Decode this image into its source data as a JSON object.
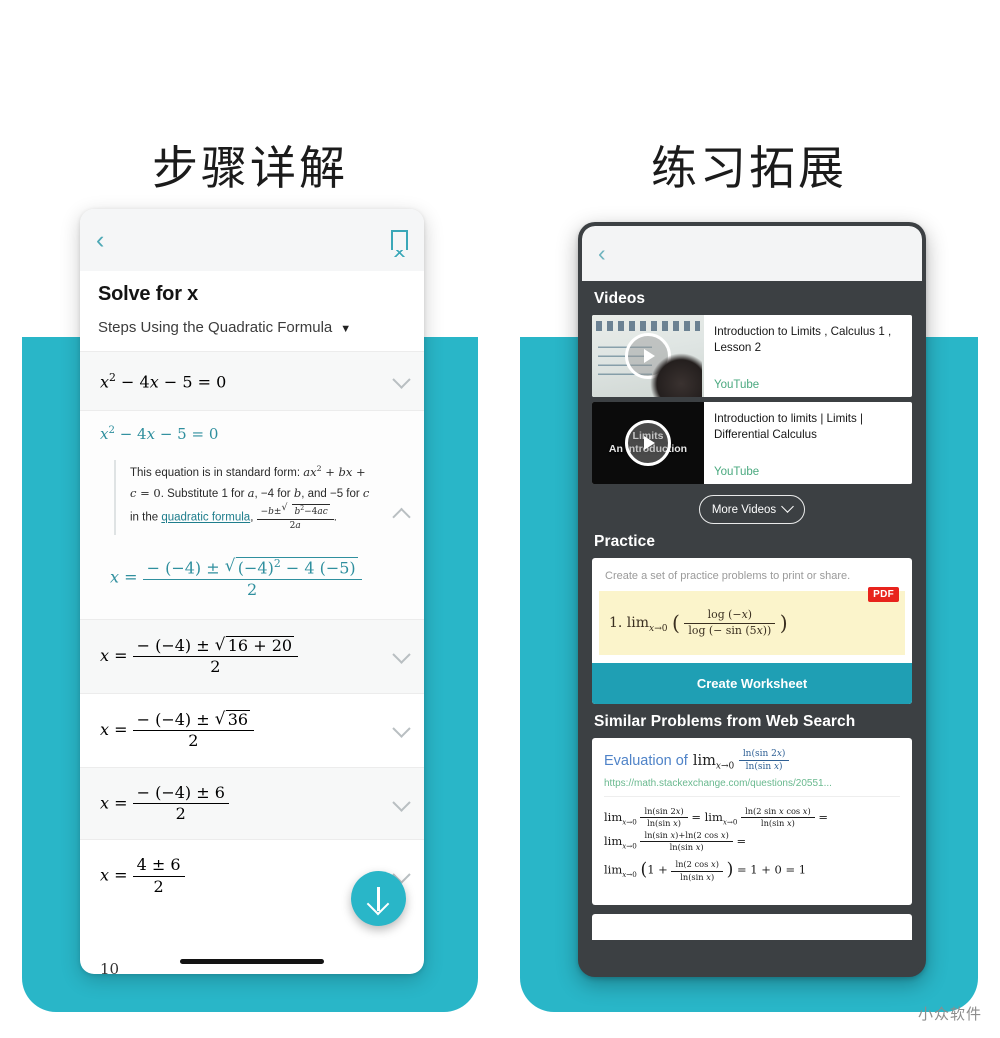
{
  "watermark": "小众软件",
  "panels": [
    {
      "title": "步骤详解",
      "appbar": {
        "back_icon": "chevron-left-icon",
        "bookmark_icon": "bookmark-icon"
      },
      "solve": {
        "title": "Solve for x",
        "method": "Steps Using the Quadratic Formula",
        "method_caret": "▼"
      },
      "steps": [
        {
          "id": "s1",
          "expr": "x² − 4x − 5 = 0",
          "state": "collapsed"
        },
        {
          "id": "s2",
          "expr": "x² − 4x − 5 = 0",
          "state": "expanded",
          "explanation_1": "This equation is in standard form: ",
          "explanation_std": "ax² + bx + c = 0",
          "explanation_2": ". Substitute 1 for a, −4 for b, and −5 for c in the ",
          "explanation_link": "quadratic formula",
          "explanation_3": ", ",
          "formula": "(−b ± √(b² − 4ac)) / 2a",
          "result": "x = ( −(−4) ± √((−4)² − 4(−5)) ) / 2"
        },
        {
          "id": "s3",
          "expr": "x = ( −(−4) ± √(16 + 20) ) / 2",
          "state": "collapsed"
        },
        {
          "id": "s4",
          "expr": "x = ( −(−4) ± √36 ) / 2",
          "state": "collapsed"
        },
        {
          "id": "s5",
          "expr": "x = ( −(−4) ± 6 ) / 2",
          "state": "collapsed"
        },
        {
          "id": "s6",
          "expr": "x = ( 4 ± 6 ) / 2",
          "state": "collapsed"
        }
      ],
      "cut_text": "10",
      "fab": {
        "icon": "download-arrow-icon"
      }
    },
    {
      "title": "练习拓展",
      "appbar": {
        "back_icon": "chevron-left-icon",
        "bookmark_icon": "bookmark-icon"
      },
      "sections": {
        "videos_heading": "Videos",
        "videos": [
          {
            "title": "Introduction to Limits , Calculus 1 , Lesson 2",
            "source": "YouTube",
            "thumb_label": ""
          },
          {
            "title": "Introduction to limits | Limits | Differential Calculus",
            "source": "YouTube",
            "thumb_label": "Limits\nAn Introduction"
          }
        ],
        "more_videos_label": "More Videos",
        "practice_heading": "Practice",
        "practice_text": "Create a set of practice problems to print or share.",
        "practice_problem_number": "1.",
        "practice_problem": "lim x→0 ( log(−x) / log(−sin(5x)) )",
        "pdf_badge": "PDF",
        "create_worksheet_label": "Create Worksheet",
        "similar_heading": "Similar Problems from Web Search",
        "similar_item": {
          "title_prefix": "Evaluation of",
          "title_lim": "lim",
          "title_sub": "x→0",
          "title_frac_num": "ln(sin 2x)",
          "title_frac_den": "ln(sin x)",
          "url": "https://math.stackexchange.com/questions/20551...",
          "line1_a": "ln(sin 2x)",
          "line1_b": "ln(sin x)",
          "line1_c": "ln(2 sin x cos x)",
          "line1_d": "ln(sin x)",
          "line2_a": "ln(sin x)+ln(2 cos x)",
          "line2_b": "ln(sin x)",
          "line3_a": "ln(2 cos x)",
          "line3_b": "ln(sin x)",
          "line3_result": "= 1 + 0 = 1"
        }
      }
    }
  ],
  "colors": {
    "teal": "#29b6c8",
    "dark": "#3c4043",
    "accent_link": "#1e7d8c",
    "pdf_red": "#e8231c",
    "youtube_green": "#4aa97f"
  }
}
